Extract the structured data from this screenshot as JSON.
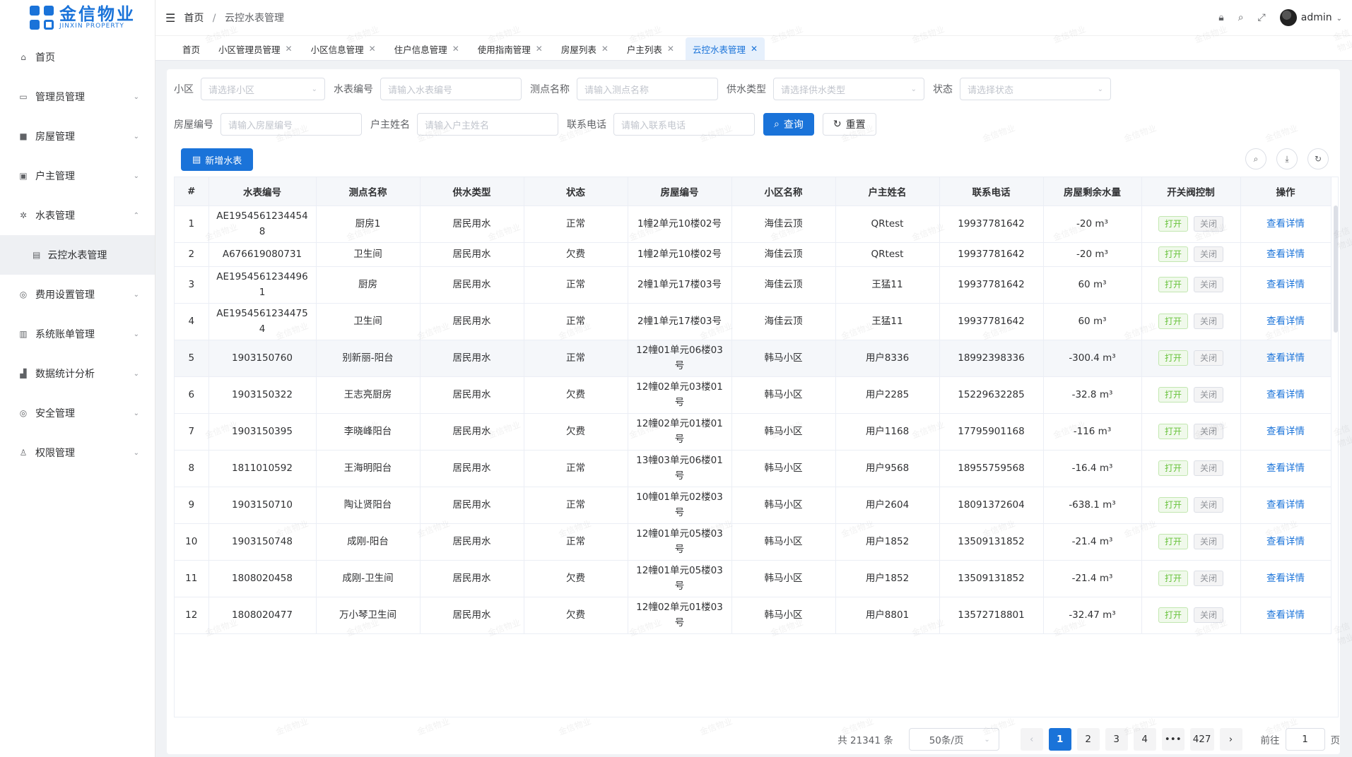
{
  "logo": {
    "cn": "金信物业",
    "en": "JINXIN PROPERTY"
  },
  "sidebar": {
    "items": [
      {
        "label": "首页",
        "icon": "home-icon",
        "glyph": "⌂",
        "arrow": ""
      },
      {
        "label": "管理员管理",
        "icon": "admin-icon",
        "glyph": "▭",
        "arrow": "⌄"
      },
      {
        "label": "房屋管理",
        "icon": "grid-icon",
        "glyph": "■",
        "arrow": "⌄"
      },
      {
        "label": "户主管理",
        "icon": "monitor-icon",
        "glyph": "▣",
        "arrow": "⌄"
      },
      {
        "label": "水表管理",
        "icon": "meter-icon",
        "glyph": "✲",
        "arrow": "⌃"
      }
    ],
    "sub_item": {
      "label": "云控水表管理",
      "icon": "doc-icon",
      "glyph": "▤"
    },
    "items_after": [
      {
        "label": "费用设置管理",
        "icon": "settings-icon",
        "glyph": "◎",
        "arrow": "⌄"
      },
      {
        "label": "系统账单管理",
        "icon": "bill-icon",
        "glyph": "▥",
        "arrow": "⌄"
      },
      {
        "label": "数据统计分析",
        "icon": "chart-icon",
        "glyph": "▟",
        "arrow": "⌄"
      },
      {
        "label": "安全管理",
        "icon": "security-icon",
        "glyph": "◎",
        "arrow": "⌄"
      },
      {
        "label": "权限管理",
        "icon": "user-icon",
        "glyph": "♙",
        "arrow": "⌄"
      }
    ]
  },
  "header": {
    "breadcrumb_home": "首页",
    "breadcrumb_sep": "/",
    "breadcrumb_current": "云控水表管理",
    "user": "admin"
  },
  "tabs": [
    {
      "label": "首页",
      "closable": false,
      "active": false
    },
    {
      "label": "小区管理员管理",
      "closable": true,
      "active": false
    },
    {
      "label": "小区信息管理",
      "closable": true,
      "active": false
    },
    {
      "label": "住户信息管理",
      "closable": true,
      "active": false
    },
    {
      "label": "使用指南管理",
      "closable": true,
      "active": false
    },
    {
      "label": "房屋列表",
      "closable": true,
      "active": false
    },
    {
      "label": "户主列表",
      "closable": true,
      "active": false
    },
    {
      "label": "云控水表管理",
      "closable": true,
      "active": true
    }
  ],
  "filters": {
    "community_label": "小区",
    "community_placeholder": "请选择小区",
    "meter_no_label": "水表编号",
    "meter_no_placeholder": "请输入水表编号",
    "point_label": "测点名称",
    "point_placeholder": "请输入测点名称",
    "supply_label": "供水类型",
    "supply_placeholder": "请选择供水类型",
    "status_label": "状态",
    "status_placeholder": "请选择状态",
    "house_label": "房屋编号",
    "house_placeholder": "请输入房屋编号",
    "owner_label": "户主姓名",
    "owner_placeholder": "请输入户主姓名",
    "phone_label": "联系电话",
    "phone_placeholder": "请输入联系电话",
    "search_label": "查询",
    "reset_label": "重置"
  },
  "toolbar": {
    "add_label": "新增水表"
  },
  "table": {
    "columns": [
      "#",
      "水表编号",
      "测点名称",
      "供水类型",
      "状态",
      "房屋编号",
      "小区名称",
      "户主姓名",
      "联系电话",
      "房屋剩余水量",
      "开关阀控制",
      "操作"
    ],
    "open_label": "打开",
    "close_label": "关闭",
    "detail_label": "查看详情",
    "rows": [
      [
        "1",
        "AE19545612344548",
        "厨房1",
        "居民用水",
        "正常",
        "1幢2单元10楼02号",
        "海佳云顶",
        "QRtest",
        "19937781642",
        "-20 m³"
      ],
      [
        "2",
        "A676619080731",
        "卫生间",
        "居民用水",
        "欠费",
        "1幢2单元10楼02号",
        "海佳云顶",
        "QRtest",
        "19937781642",
        "-20 m³"
      ],
      [
        "3",
        "AE19545612344961",
        "厨房",
        "居民用水",
        "正常",
        "2幢1单元17楼03号",
        "海佳云顶",
        "王猛11",
        "19937781642",
        "60 m³"
      ],
      [
        "4",
        "AE19545612344754",
        "卫生间",
        "居民用水",
        "正常",
        "2幢1单元17楼03号",
        "海佳云顶",
        "王猛11",
        "19937781642",
        "60 m³"
      ],
      [
        "5",
        "1903150760",
        "别新丽-阳台",
        "居民用水",
        "正常",
        "12幢01单元06楼03号",
        "韩马小区",
        "用户8336",
        "18992398336",
        "-300.4 m³"
      ],
      [
        "6",
        "1903150322",
        "王志亮厨房",
        "居民用水",
        "欠费",
        "12幢02单元03楼01号",
        "韩马小区",
        "用户2285",
        "15229632285",
        "-32.8 m³"
      ],
      [
        "7",
        "1903150395",
        "李晓峰阳台",
        "居民用水",
        "欠费",
        "12幢02单元01楼01号",
        "韩马小区",
        "用户1168",
        "17795901168",
        "-116 m³"
      ],
      [
        "8",
        "1811010592",
        "王海明阳台",
        "居民用水",
        "正常",
        "13幢03单元06楼01号",
        "韩马小区",
        "用户9568",
        "18955759568",
        "-16.4 m³"
      ],
      [
        "9",
        "1903150710",
        "陶让贤阳台",
        "居民用水",
        "正常",
        "10幢01单元02楼03号",
        "韩马小区",
        "用户2604",
        "18091372604",
        "-638.1 m³"
      ],
      [
        "10",
        "1903150748",
        "成刚-阳台",
        "居民用水",
        "正常",
        "12幢01单元05楼03号",
        "韩马小区",
        "用户1852",
        "13509131852",
        "-21.4 m³"
      ],
      [
        "11",
        "1808020458",
        "成刚-卫生间",
        "居民用水",
        "欠费",
        "12幢01单元05楼03号",
        "韩马小区",
        "用户1852",
        "13509131852",
        "-21.4 m³"
      ],
      [
        "12",
        "1808020477",
        "万小琴卫生间",
        "居民用水",
        "欠费",
        "12幢02单元01楼03号",
        "韩马小区",
        "用户8801",
        "13572718801",
        "-32.47 m³"
      ]
    ]
  },
  "pagination": {
    "total": "共 21341 条",
    "page_size": "50条/页",
    "pages": [
      "1",
      "2",
      "3",
      "4",
      "•••",
      "427"
    ],
    "current_page": "1",
    "goto_label": "前往",
    "goto_value": "1",
    "goto_suffix": "页"
  },
  "colors": {
    "primary": "#1a73d9",
    "open_green": "#67c23a"
  }
}
